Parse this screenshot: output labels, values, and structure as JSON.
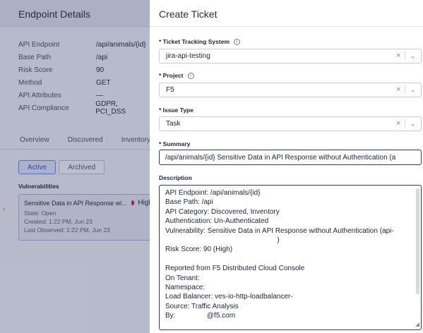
{
  "endpoint_details": {
    "title": "Endpoint Details",
    "rows": [
      {
        "key": "API Endpoint",
        "value": "/api/animals/{id}"
      },
      {
        "key": "Base Path",
        "value": "/api"
      },
      {
        "key": "Risk Score",
        "value": "90"
      },
      {
        "key": "Method",
        "value": "GET"
      },
      {
        "key": "API Attributes",
        "value": "—"
      },
      {
        "key": "API Compliance",
        "value": "GDPR, PCI_DSS"
      }
    ],
    "tabs": [
      "Overview",
      "Discovered",
      "Inventory"
    ],
    "segment": {
      "active": "Active",
      "archived": "Archived"
    },
    "vulnerabilities_heading": "Vulnerabilities",
    "card": {
      "title": "Sensitive Data in API Response wi...",
      "severity": "High",
      "severity_color": "#d0273a",
      "state": "State: Open",
      "created": "Created: 1:22 PM, Jun 23",
      "last_observed": "Last Observed: 1:22 PM, Jun 23"
    }
  },
  "create_ticket": {
    "title": "Create Ticket",
    "tracking_system": {
      "label": "* Ticket Tracking System",
      "value": "jira-api-testing"
    },
    "project": {
      "label": "* Project",
      "value": "F5"
    },
    "issue_type": {
      "label": "* Issue Type",
      "value": "Task"
    },
    "summary": {
      "label": "* Summary",
      "value": "/api/animals/{id} Sensitive Data in API Response without Authentication  (a"
    },
    "description": {
      "label": "Description",
      "lines": [
        "API Endpoint:   /api/animals/{id}",
        "Base Path:   /api",
        "API Category:   Discovered, Inventory",
        "Authentication:   Un-Authenticated",
        "Vulnerability:   Sensitive Data in API Response without Authentication  (api-",
        "                                                         )",
        "Risk Score:   90 (High)",
        "",
        "Reported from F5 Distributed Cloud Console",
        "On Tenant:",
        "Namespace:",
        "Load Balancer:   ves-io-http-loadbalancer-",
        "Source:   Traffic Analysis",
        "By:                @f5.com"
      ]
    }
  }
}
